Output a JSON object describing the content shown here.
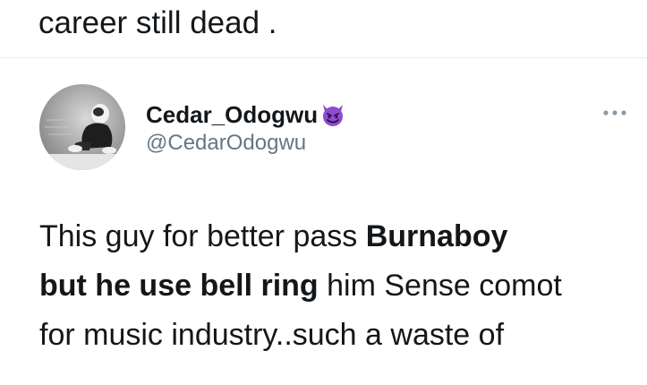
{
  "previous_tweet": {
    "text": "career still dead ."
  },
  "author": {
    "display_name": "Cedar_Odogwu",
    "badge_icon": "smiling-devil-emoji-icon",
    "handle": "@CedarOdogwu",
    "avatar": "profile-photo-baby-icon"
  },
  "menu": {
    "icon": "more-options-icon"
  },
  "tweet": {
    "line1_normal": "This guy for better pass ",
    "line1_bold": "Burnaboy",
    "line2_bold": "but he use bell ring",
    "line2_normal": " him Sense comot",
    "line3_normal": "for music industry..such a waste of"
  },
  "colors": {
    "text_primary": "#14171a",
    "text_secondary": "#657786",
    "emoji_purple": "#8f4bd0",
    "divider": "#e6ecf0"
  }
}
